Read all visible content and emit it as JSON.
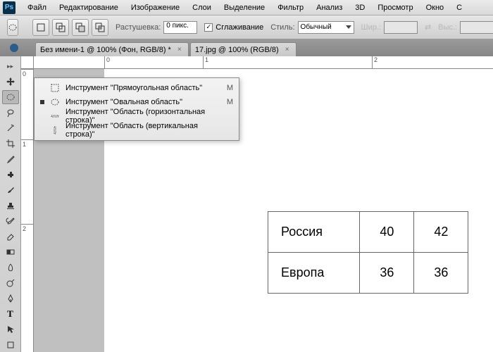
{
  "menu": [
    "Файл",
    "Редактирование",
    "Изображение",
    "Слои",
    "Выделение",
    "Фильтр",
    "Анализ",
    "3D",
    "Просмотр",
    "Окно",
    "С"
  ],
  "options": {
    "feather_label": "Растушевка:",
    "feather_value": "0 пикс.",
    "antialias_label": "Сглаживание",
    "antialias_checked": "✓",
    "style_label": "Стиль:",
    "style_value": "Обычный",
    "width_label": "Шир.:",
    "height_label": "Выс.:"
  },
  "tabs": [
    {
      "label": "Без имени-1 @ 100% (Фон, RGB/8) *"
    },
    {
      "label": "17.jpg @ 100% (RGB/8)"
    }
  ],
  "ruler": {
    "h": [
      "0",
      "1",
      "2"
    ],
    "v": [
      "0",
      "1",
      "2"
    ]
  },
  "flyout": [
    {
      "selected": false,
      "icon": "rect",
      "label": "Инструмент \"Прямоугольная область\"",
      "shortcut": "M"
    },
    {
      "selected": true,
      "icon": "ellipse",
      "label": "Инструмент \"Овальная область\"",
      "shortcut": "M"
    },
    {
      "selected": false,
      "icon": "row",
      "label": "Инструмент \"Область (горизонтальная строка)\"",
      "shortcut": ""
    },
    {
      "selected": false,
      "icon": "col",
      "label": "Инструмент \"Область (вертикальная строка)\"",
      "shortcut": ""
    }
  ],
  "doc_table": {
    "rows": [
      {
        "label": "Россия",
        "c1": "40",
        "c2": "42"
      },
      {
        "label": "Европа",
        "c1": "36",
        "c2": "36"
      }
    ]
  }
}
